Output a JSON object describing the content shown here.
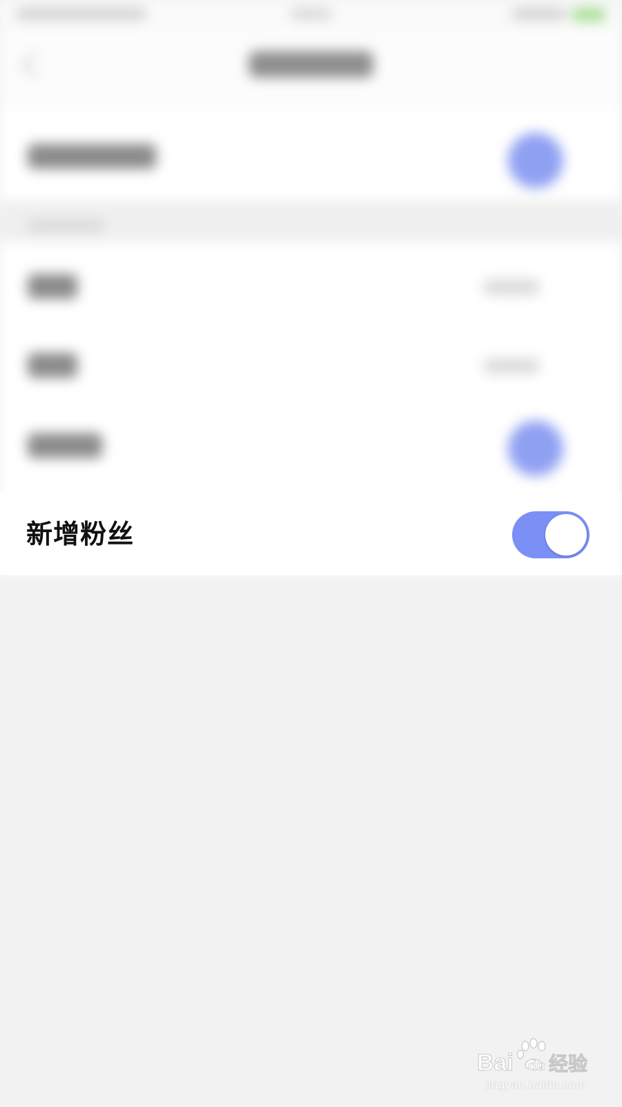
{
  "settings_row": {
    "label": "新增粉丝",
    "toggle_on": true
  },
  "colors": {
    "toggle_on": "#7b8ff5",
    "row_background": "#ffffff",
    "page_background": "#f2f2f2",
    "label_text": "#111111"
  },
  "watermark": {
    "logo_text": "Bai du 经验",
    "url": "jingyan.baidu.com"
  }
}
